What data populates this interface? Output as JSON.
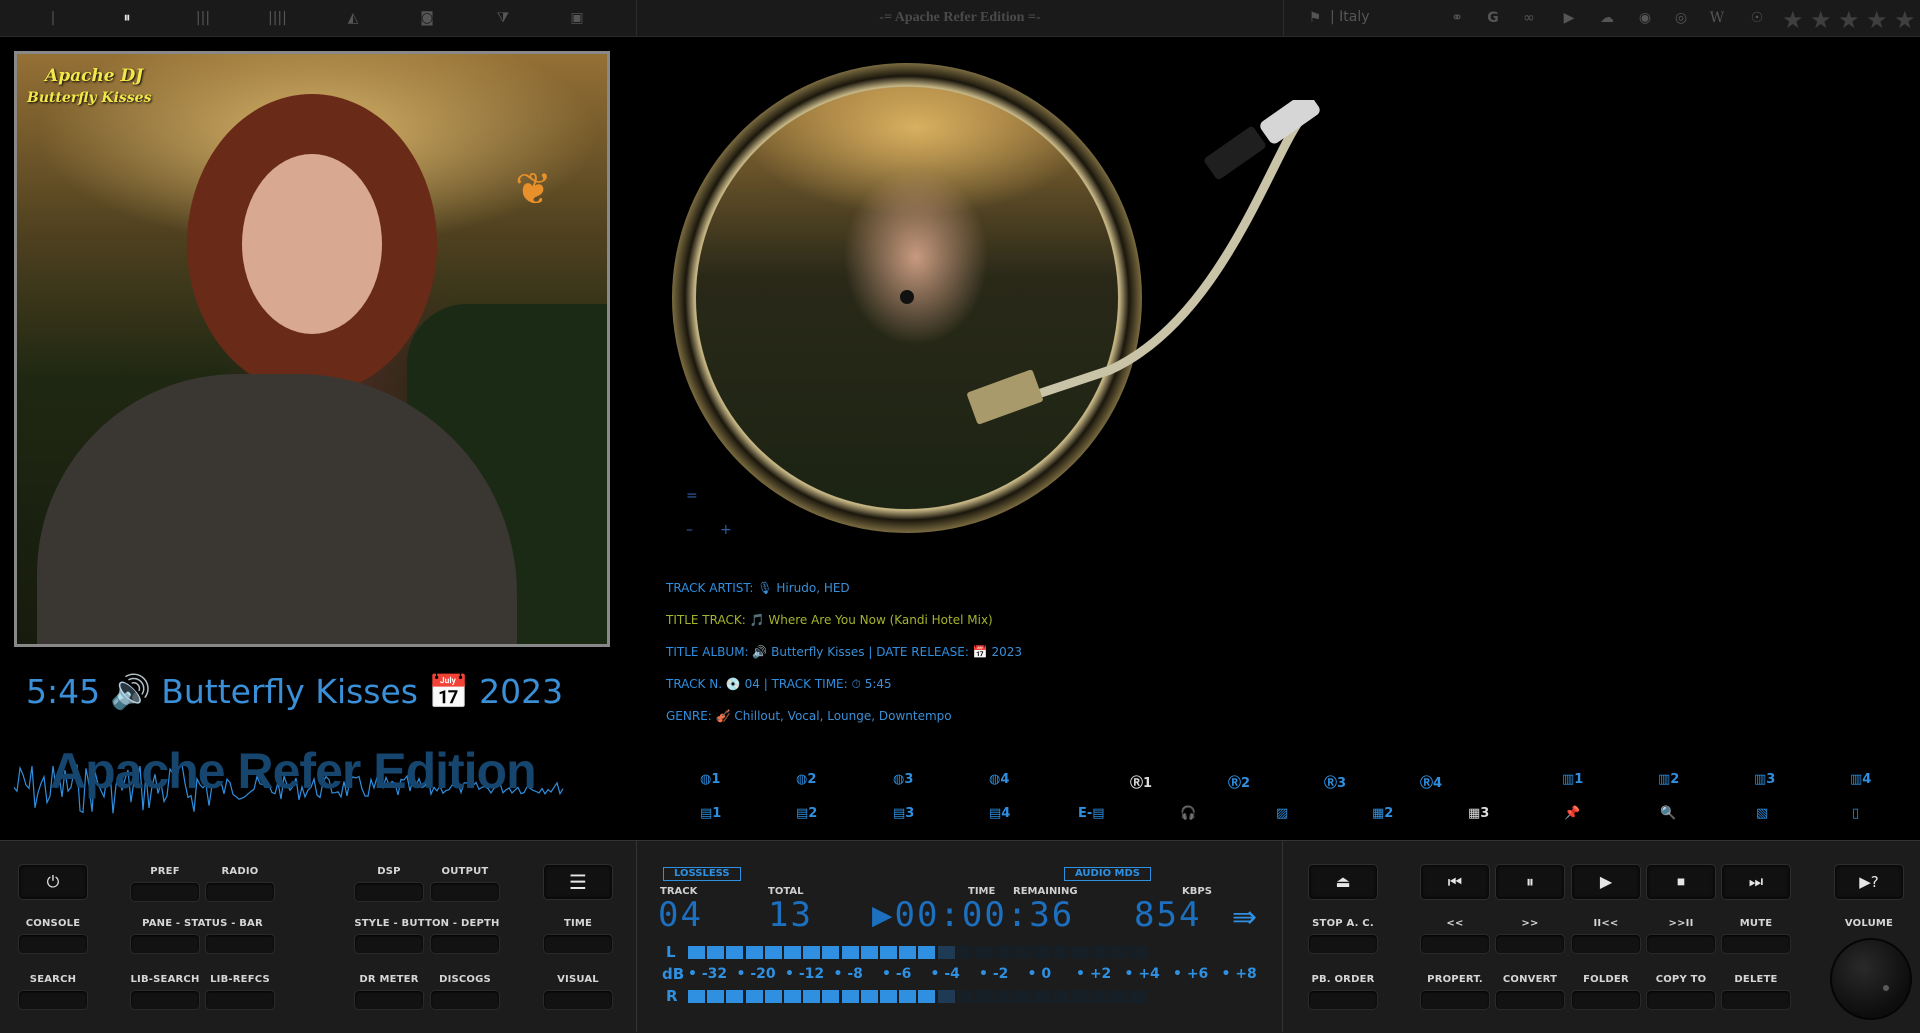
{
  "topbar": {
    "title": "-= Apache Refer Edition =-",
    "country": "| Italy",
    "icons": [
      "pipe-icon",
      "pause-icon",
      "bars3-icon",
      "bars4-icon",
      "triangle-up-icon",
      "circle-dot-icon",
      "triangle-down-icon",
      "square-icon"
    ],
    "web_icons": [
      "link-icon",
      "google-icon",
      "lastfm-icon",
      "youtube-icon",
      "soundcloud-icon",
      "spotify-icon",
      "target-icon",
      "wikipedia-icon",
      "podcast-icon"
    ],
    "rating_stars": 5
  },
  "art": {
    "line1": "Apache DJ",
    "line2": "Butterfly Kisses"
  },
  "now_playing": {
    "time": "5:45",
    "album": "Butterfly Kisses",
    "year": "2023",
    "wave_title": "Apache Refer Edition"
  },
  "side": {
    "eq": "=",
    "minus": "–",
    "plus": "+"
  },
  "track_info": {
    "artist_label": "TRACK ARTIST:",
    "artist": "🎙 Hirudo, HED",
    "title_label": "TITLE TRACK:",
    "title": "🎵 Where Are You Now (Kandi Hotel Mix)",
    "album_label": "TITLE ALBUM:",
    "album": "🔊 Butterfly Kisses",
    "release_label": "| DATE RELEASE:",
    "release": "📅 2023",
    "trackn_label": "TRACK N.",
    "trackn": "💿 04",
    "tracktime_label": "| TRACK TIME:",
    "tracktime": "⏱ 5:45",
    "genre_label": "GENRE:",
    "genre": "🎻 Chillout, Vocal, Lounge, Downtempo"
  },
  "tabs_row1": [
    "◍1",
    "◍2",
    "◍3",
    "◍4",
    "Ⓡ1",
    "Ⓡ2",
    "Ⓡ3",
    "Ⓡ4",
    "▥1",
    "▥2",
    "▥3",
    "▥4"
  ],
  "tabs_row2": [
    "▤1",
    "▤2",
    "▤3",
    "▤4",
    "E-▤",
    "🎧",
    "▨",
    "▦2",
    "▦3",
    "📌",
    "🔍",
    "▧",
    "▯"
  ],
  "left_buttons": {
    "power": "⏻",
    "pref": "PREF",
    "radio": "RADIO",
    "dsp": "DSP",
    "output": "OUTPUT",
    "menu": "☰",
    "console": "CONSOLE",
    "pane": "PANE - STATUS - BAR",
    "style": "STYLE - BUTTON - DEPTH",
    "time": "TIME",
    "search": "SEARCH",
    "libsearch": "LIB-SEARCH",
    "librefcs": "LIB-REFCS",
    "drmeter": "DR METER",
    "discogs": "DISCOGS",
    "visual": "VISUAL"
  },
  "display": {
    "lossless": "LOSSLESS",
    "audio_mds": "AUDIO MDS",
    "track_label": "TRACK",
    "track": "04",
    "total_label": "TOTAL",
    "total": "13",
    "time_label": "TIME",
    "remaining_label": "REMAINING",
    "time": "▶00:00:36",
    "kbps_label": "KBPS",
    "kbps": "854",
    "arrow": "⇛",
    "meter_left_label": "L",
    "meter_db_label": "dB",
    "meter_right_label": "R",
    "db_scale": [
      "-32",
      "-20",
      "-12",
      "-8",
      "-6",
      "-4",
      "-2",
      "0",
      "+2",
      "+4",
      "+6",
      "+8"
    ],
    "meter_l_level": 0.55,
    "meter_r_level": 0.55
  },
  "right_buttons": {
    "eject": "⏏",
    "prev": "⏮",
    "pause": "⏸",
    "play": "▶",
    "stop": "⏹",
    "next": "⏭",
    "help": "▶?",
    "stop_ac": "STOP A. C.",
    "rew": "<<",
    "ffw": ">>",
    "prev_track": "II<<",
    "next_track": ">>II",
    "mute": "MUTE",
    "volume": "VOLUME",
    "pb_order": "PB. ORDER",
    "propert": "PROPERT.",
    "convert": "CONVERT",
    "folder": "FOLDER",
    "copy_to": "COPY TO",
    "delete": "DELETE"
  },
  "colors": {
    "accent": "#2f8fe0",
    "meter_on": "#2f8fe0",
    "meter_off": "#1f3a55"
  }
}
